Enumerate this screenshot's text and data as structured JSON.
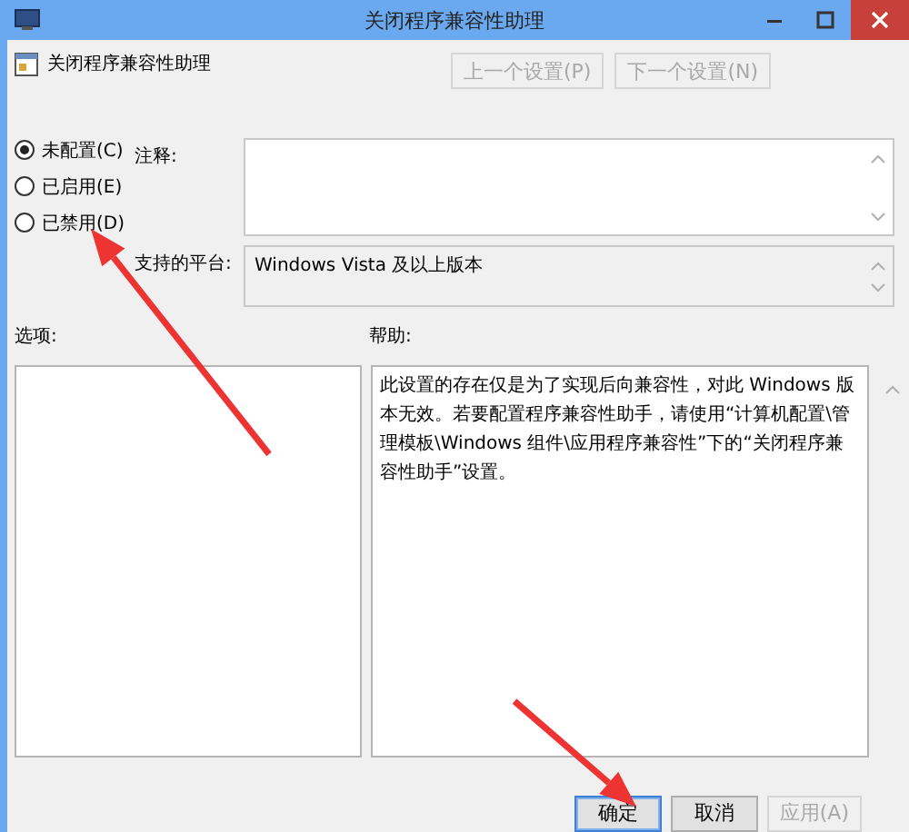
{
  "window": {
    "title": "关闭程序兼容性助理"
  },
  "policy": {
    "name": "关闭程序兼容性助理"
  },
  "nav_buttons": [
    {
      "label": "上一个设置(P)",
      "disabled": true
    },
    {
      "label": "下一个设置(N)",
      "disabled": true
    }
  ],
  "state_options": [
    {
      "label": "未配置(C)",
      "selected": true
    },
    {
      "label": "已启用(E)",
      "selected": false
    },
    {
      "label": "已禁用(D)",
      "selected": false
    }
  ],
  "comment": {
    "label": "注释:"
  },
  "supported_on": {
    "label": "支持的平台:",
    "value": "Windows Vista 及以上版本"
  },
  "options": {
    "label": "选项:"
  },
  "help": {
    "label": "帮助:",
    "text": "此设置的存在仅是为了实现后向兼容性，对此 Windows 版本无效。若要配置程序兼容性助手，请使用“计算机配置\\管理模板\\Windows 组件\\应用程序兼容性”下的“关闭程序兼容性助手”设置。"
  },
  "buttons": [
    {
      "label": "确定",
      "default": true,
      "disabled": false
    },
    {
      "label": "取消",
      "default": false,
      "disabled": false
    },
    {
      "label": "应用(A)",
      "default": false,
      "disabled": true
    }
  ],
  "annotations": [
    {
      "kind": "arrow"
    },
    {
      "kind": "arrow"
    }
  ]
}
